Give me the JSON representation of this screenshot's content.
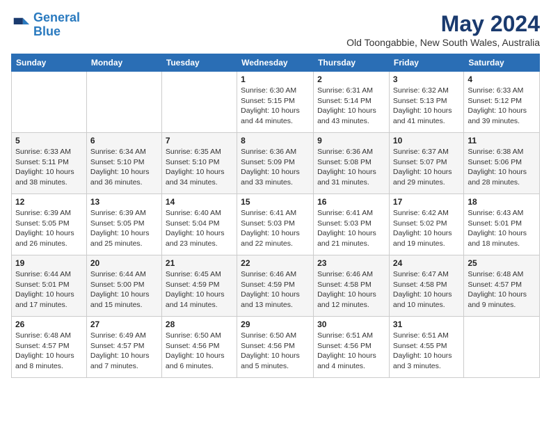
{
  "logo": {
    "line1": "General",
    "line2": "Blue"
  },
  "title": "May 2024",
  "subtitle": "Old Toongabbie, New South Wales, Australia",
  "days_header": [
    "Sunday",
    "Monday",
    "Tuesday",
    "Wednesday",
    "Thursday",
    "Friday",
    "Saturday"
  ],
  "weeks": [
    [
      {
        "day": "",
        "info": ""
      },
      {
        "day": "",
        "info": ""
      },
      {
        "day": "",
        "info": ""
      },
      {
        "day": "1",
        "info": "Sunrise: 6:30 AM\nSunset: 5:15 PM\nDaylight: 10 hours\nand 44 minutes."
      },
      {
        "day": "2",
        "info": "Sunrise: 6:31 AM\nSunset: 5:14 PM\nDaylight: 10 hours\nand 43 minutes."
      },
      {
        "day": "3",
        "info": "Sunrise: 6:32 AM\nSunset: 5:13 PM\nDaylight: 10 hours\nand 41 minutes."
      },
      {
        "day": "4",
        "info": "Sunrise: 6:33 AM\nSunset: 5:12 PM\nDaylight: 10 hours\nand 39 minutes."
      }
    ],
    [
      {
        "day": "5",
        "info": "Sunrise: 6:33 AM\nSunset: 5:11 PM\nDaylight: 10 hours\nand 38 minutes."
      },
      {
        "day": "6",
        "info": "Sunrise: 6:34 AM\nSunset: 5:10 PM\nDaylight: 10 hours\nand 36 minutes."
      },
      {
        "day": "7",
        "info": "Sunrise: 6:35 AM\nSunset: 5:10 PM\nDaylight: 10 hours\nand 34 minutes."
      },
      {
        "day": "8",
        "info": "Sunrise: 6:36 AM\nSunset: 5:09 PM\nDaylight: 10 hours\nand 33 minutes."
      },
      {
        "day": "9",
        "info": "Sunrise: 6:36 AM\nSunset: 5:08 PM\nDaylight: 10 hours\nand 31 minutes."
      },
      {
        "day": "10",
        "info": "Sunrise: 6:37 AM\nSunset: 5:07 PM\nDaylight: 10 hours\nand 29 minutes."
      },
      {
        "day": "11",
        "info": "Sunrise: 6:38 AM\nSunset: 5:06 PM\nDaylight: 10 hours\nand 28 minutes."
      }
    ],
    [
      {
        "day": "12",
        "info": "Sunrise: 6:39 AM\nSunset: 5:05 PM\nDaylight: 10 hours\nand 26 minutes."
      },
      {
        "day": "13",
        "info": "Sunrise: 6:39 AM\nSunset: 5:05 PM\nDaylight: 10 hours\nand 25 minutes."
      },
      {
        "day": "14",
        "info": "Sunrise: 6:40 AM\nSunset: 5:04 PM\nDaylight: 10 hours\nand 23 minutes."
      },
      {
        "day": "15",
        "info": "Sunrise: 6:41 AM\nSunset: 5:03 PM\nDaylight: 10 hours\nand 22 minutes."
      },
      {
        "day": "16",
        "info": "Sunrise: 6:41 AM\nSunset: 5:03 PM\nDaylight: 10 hours\nand 21 minutes."
      },
      {
        "day": "17",
        "info": "Sunrise: 6:42 AM\nSunset: 5:02 PM\nDaylight: 10 hours\nand 19 minutes."
      },
      {
        "day": "18",
        "info": "Sunrise: 6:43 AM\nSunset: 5:01 PM\nDaylight: 10 hours\nand 18 minutes."
      }
    ],
    [
      {
        "day": "19",
        "info": "Sunrise: 6:44 AM\nSunset: 5:01 PM\nDaylight: 10 hours\nand 17 minutes."
      },
      {
        "day": "20",
        "info": "Sunrise: 6:44 AM\nSunset: 5:00 PM\nDaylight: 10 hours\nand 15 minutes."
      },
      {
        "day": "21",
        "info": "Sunrise: 6:45 AM\nSunset: 4:59 PM\nDaylight: 10 hours\nand 14 minutes."
      },
      {
        "day": "22",
        "info": "Sunrise: 6:46 AM\nSunset: 4:59 PM\nDaylight: 10 hours\nand 13 minutes."
      },
      {
        "day": "23",
        "info": "Sunrise: 6:46 AM\nSunset: 4:58 PM\nDaylight: 10 hours\nand 12 minutes."
      },
      {
        "day": "24",
        "info": "Sunrise: 6:47 AM\nSunset: 4:58 PM\nDaylight: 10 hours\nand 10 minutes."
      },
      {
        "day": "25",
        "info": "Sunrise: 6:48 AM\nSunset: 4:57 PM\nDaylight: 10 hours\nand 9 minutes."
      }
    ],
    [
      {
        "day": "26",
        "info": "Sunrise: 6:48 AM\nSunset: 4:57 PM\nDaylight: 10 hours\nand 8 minutes."
      },
      {
        "day": "27",
        "info": "Sunrise: 6:49 AM\nSunset: 4:57 PM\nDaylight: 10 hours\nand 7 minutes."
      },
      {
        "day": "28",
        "info": "Sunrise: 6:50 AM\nSunset: 4:56 PM\nDaylight: 10 hours\nand 6 minutes."
      },
      {
        "day": "29",
        "info": "Sunrise: 6:50 AM\nSunset: 4:56 PM\nDaylight: 10 hours\nand 5 minutes."
      },
      {
        "day": "30",
        "info": "Sunrise: 6:51 AM\nSunset: 4:56 PM\nDaylight: 10 hours\nand 4 minutes."
      },
      {
        "day": "31",
        "info": "Sunrise: 6:51 AM\nSunset: 4:55 PM\nDaylight: 10 hours\nand 3 minutes."
      },
      {
        "day": "",
        "info": ""
      }
    ]
  ]
}
